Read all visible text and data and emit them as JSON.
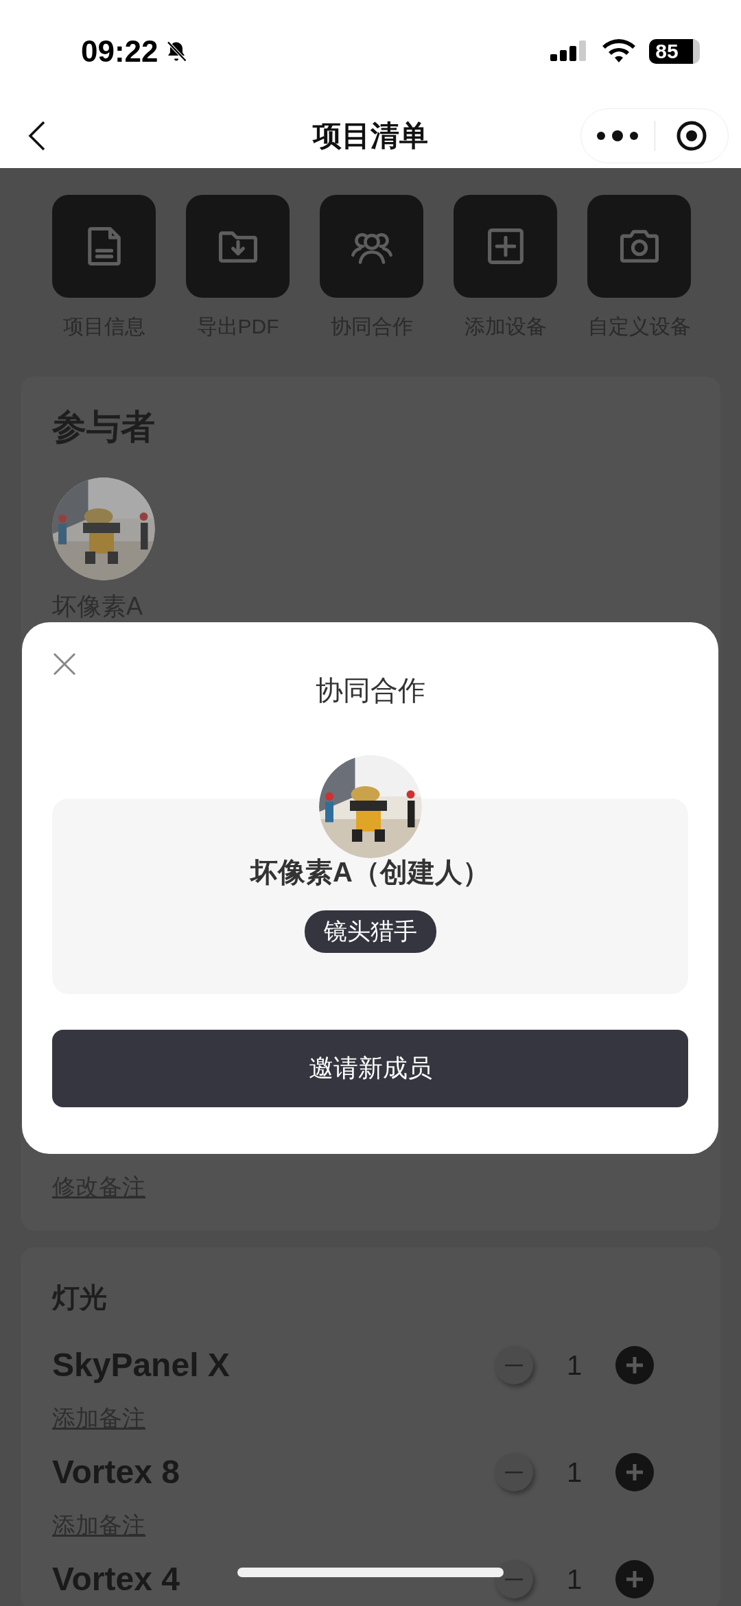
{
  "status_bar": {
    "time": "09:22",
    "battery": "85"
  },
  "nav": {
    "title": "项目清单"
  },
  "actions": [
    {
      "label": "项目信息",
      "kind": "document"
    },
    {
      "label": "导出PDF",
      "kind": "export"
    },
    {
      "label": "协同合作",
      "kind": "people"
    },
    {
      "label": "添加设备",
      "kind": "add"
    },
    {
      "label": "自定义设备",
      "kind": "camera"
    }
  ],
  "participants": {
    "title": "参与者",
    "members": [
      {
        "name": "坏像素A"
      }
    ],
    "edit_note": "修改备注"
  },
  "categories": [
    {
      "title": "灯光",
      "items": [
        {
          "name": "SkyPanel X",
          "count": "1",
          "note": "添加备注"
        },
        {
          "name": "Vortex 8",
          "count": "1",
          "note": "添加备注"
        },
        {
          "name": "Vortex 4",
          "count": "1"
        }
      ]
    }
  ],
  "modal": {
    "title": "协同合作",
    "members": [
      {
        "name": "坏像素A（创建人）",
        "badge": "镜头猎手"
      }
    ],
    "button": "邀请新成员"
  }
}
